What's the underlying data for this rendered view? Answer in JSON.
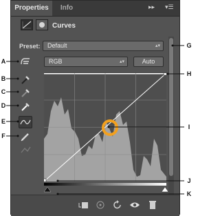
{
  "tabs": {
    "active": "Properties",
    "inactive": "Info",
    "forward_glyph": "▸▸",
    "menu_glyph": "▾☰"
  },
  "header": {
    "title": "Curves"
  },
  "preset": {
    "label": "Preset:",
    "value": "Default"
  },
  "channel": {
    "value": "RGB",
    "auto_label": "Auto"
  },
  "callouts": {
    "A": "A",
    "B": "B",
    "C": "C",
    "D": "D",
    "E": "E",
    "F": "F",
    "G": "G",
    "H": "H",
    "I": "I",
    "J": "J",
    "K": "K"
  },
  "icons": {
    "adjust": "adjust-hand-icon",
    "black_dropper": "black-eyedropper-icon",
    "gray_dropper": "gray-eyedropper-icon",
    "white_dropper": "white-eyedropper-icon",
    "curve_mode": "curve-mode-icon",
    "pencil_mode": "pencil-mode-icon",
    "smooth": "smooth-icon"
  },
  "colors": {
    "panel": "#535353",
    "highlight_ring": "#f2a01f"
  }
}
